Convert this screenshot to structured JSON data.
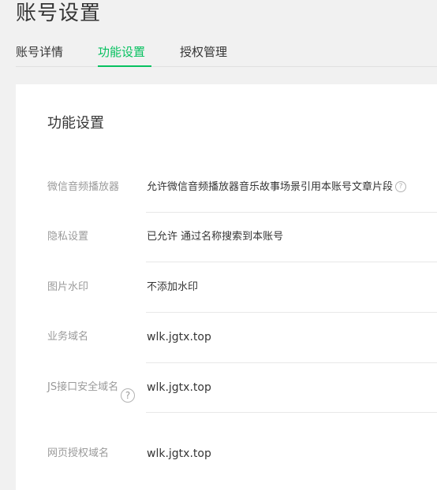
{
  "page": {
    "title": "账号设置"
  },
  "tabs": [
    {
      "label": "账号详情"
    },
    {
      "label": "功能设置"
    },
    {
      "label": "授权管理"
    }
  ],
  "active_tab": "功能设置",
  "accent_color": "#07c160",
  "card": {
    "title": "功能设置",
    "rows": [
      {
        "label": "微信音频播放器",
        "value": "允许微信音频播放器音乐故事场景引用本账号文章片段",
        "icon": "help-icon"
      },
      {
        "label": "隐私设置",
        "value": "已允许 通过名称搜索到本账号"
      },
      {
        "label": "图片水印",
        "value": "不添加水印"
      },
      {
        "label": "业务域名",
        "value": "wlk.jgtx.top"
      },
      {
        "label": "JS接口安全域名",
        "value": "wlk.jgtx.top",
        "icon": "help-icon"
      },
      {
        "label": "网页授权域名",
        "value": "wlk.jgtx.top"
      }
    ]
  }
}
